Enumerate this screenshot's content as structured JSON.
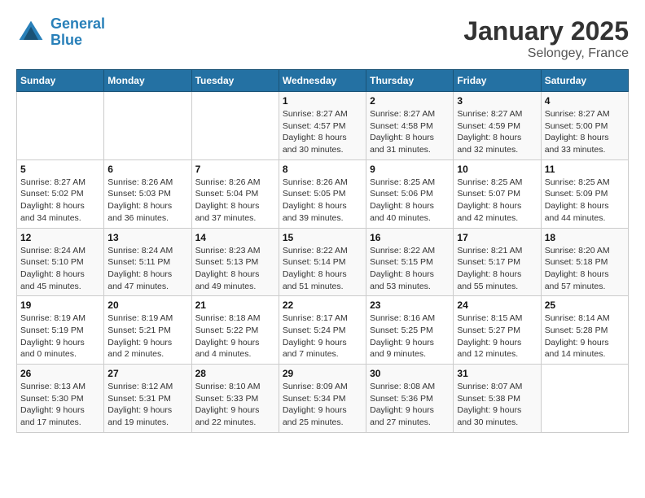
{
  "header": {
    "logo_line1": "General",
    "logo_line2": "Blue",
    "month": "January 2025",
    "location": "Selongey, France"
  },
  "weekdays": [
    "Sunday",
    "Monday",
    "Tuesday",
    "Wednesday",
    "Thursday",
    "Friday",
    "Saturday"
  ],
  "weeks": [
    [
      {
        "day": "",
        "info": ""
      },
      {
        "day": "",
        "info": ""
      },
      {
        "day": "",
        "info": ""
      },
      {
        "day": "1",
        "info": "Sunrise: 8:27 AM\nSunset: 4:57 PM\nDaylight: 8 hours\nand 30 minutes."
      },
      {
        "day": "2",
        "info": "Sunrise: 8:27 AM\nSunset: 4:58 PM\nDaylight: 8 hours\nand 31 minutes."
      },
      {
        "day": "3",
        "info": "Sunrise: 8:27 AM\nSunset: 4:59 PM\nDaylight: 8 hours\nand 32 minutes."
      },
      {
        "day": "4",
        "info": "Sunrise: 8:27 AM\nSunset: 5:00 PM\nDaylight: 8 hours\nand 33 minutes."
      }
    ],
    [
      {
        "day": "5",
        "info": "Sunrise: 8:27 AM\nSunset: 5:02 PM\nDaylight: 8 hours\nand 34 minutes."
      },
      {
        "day": "6",
        "info": "Sunrise: 8:26 AM\nSunset: 5:03 PM\nDaylight: 8 hours\nand 36 minutes."
      },
      {
        "day": "7",
        "info": "Sunrise: 8:26 AM\nSunset: 5:04 PM\nDaylight: 8 hours\nand 37 minutes."
      },
      {
        "day": "8",
        "info": "Sunrise: 8:26 AM\nSunset: 5:05 PM\nDaylight: 8 hours\nand 39 minutes."
      },
      {
        "day": "9",
        "info": "Sunrise: 8:25 AM\nSunset: 5:06 PM\nDaylight: 8 hours\nand 40 minutes."
      },
      {
        "day": "10",
        "info": "Sunrise: 8:25 AM\nSunset: 5:07 PM\nDaylight: 8 hours\nand 42 minutes."
      },
      {
        "day": "11",
        "info": "Sunrise: 8:25 AM\nSunset: 5:09 PM\nDaylight: 8 hours\nand 44 minutes."
      }
    ],
    [
      {
        "day": "12",
        "info": "Sunrise: 8:24 AM\nSunset: 5:10 PM\nDaylight: 8 hours\nand 45 minutes."
      },
      {
        "day": "13",
        "info": "Sunrise: 8:24 AM\nSunset: 5:11 PM\nDaylight: 8 hours\nand 47 minutes."
      },
      {
        "day": "14",
        "info": "Sunrise: 8:23 AM\nSunset: 5:13 PM\nDaylight: 8 hours\nand 49 minutes."
      },
      {
        "day": "15",
        "info": "Sunrise: 8:22 AM\nSunset: 5:14 PM\nDaylight: 8 hours\nand 51 minutes."
      },
      {
        "day": "16",
        "info": "Sunrise: 8:22 AM\nSunset: 5:15 PM\nDaylight: 8 hours\nand 53 minutes."
      },
      {
        "day": "17",
        "info": "Sunrise: 8:21 AM\nSunset: 5:17 PM\nDaylight: 8 hours\nand 55 minutes."
      },
      {
        "day": "18",
        "info": "Sunrise: 8:20 AM\nSunset: 5:18 PM\nDaylight: 8 hours\nand 57 minutes."
      }
    ],
    [
      {
        "day": "19",
        "info": "Sunrise: 8:19 AM\nSunset: 5:19 PM\nDaylight: 9 hours\nand 0 minutes."
      },
      {
        "day": "20",
        "info": "Sunrise: 8:19 AM\nSunset: 5:21 PM\nDaylight: 9 hours\nand 2 minutes."
      },
      {
        "day": "21",
        "info": "Sunrise: 8:18 AM\nSunset: 5:22 PM\nDaylight: 9 hours\nand 4 minutes."
      },
      {
        "day": "22",
        "info": "Sunrise: 8:17 AM\nSunset: 5:24 PM\nDaylight: 9 hours\nand 7 minutes."
      },
      {
        "day": "23",
        "info": "Sunrise: 8:16 AM\nSunset: 5:25 PM\nDaylight: 9 hours\nand 9 minutes."
      },
      {
        "day": "24",
        "info": "Sunrise: 8:15 AM\nSunset: 5:27 PM\nDaylight: 9 hours\nand 12 minutes."
      },
      {
        "day": "25",
        "info": "Sunrise: 8:14 AM\nSunset: 5:28 PM\nDaylight: 9 hours\nand 14 minutes."
      }
    ],
    [
      {
        "day": "26",
        "info": "Sunrise: 8:13 AM\nSunset: 5:30 PM\nDaylight: 9 hours\nand 17 minutes."
      },
      {
        "day": "27",
        "info": "Sunrise: 8:12 AM\nSunset: 5:31 PM\nDaylight: 9 hours\nand 19 minutes."
      },
      {
        "day": "28",
        "info": "Sunrise: 8:10 AM\nSunset: 5:33 PM\nDaylight: 9 hours\nand 22 minutes."
      },
      {
        "day": "29",
        "info": "Sunrise: 8:09 AM\nSunset: 5:34 PM\nDaylight: 9 hours\nand 25 minutes."
      },
      {
        "day": "30",
        "info": "Sunrise: 8:08 AM\nSunset: 5:36 PM\nDaylight: 9 hours\nand 27 minutes."
      },
      {
        "day": "31",
        "info": "Sunrise: 8:07 AM\nSunset: 5:38 PM\nDaylight: 9 hours\nand 30 minutes."
      },
      {
        "day": "",
        "info": ""
      }
    ]
  ]
}
